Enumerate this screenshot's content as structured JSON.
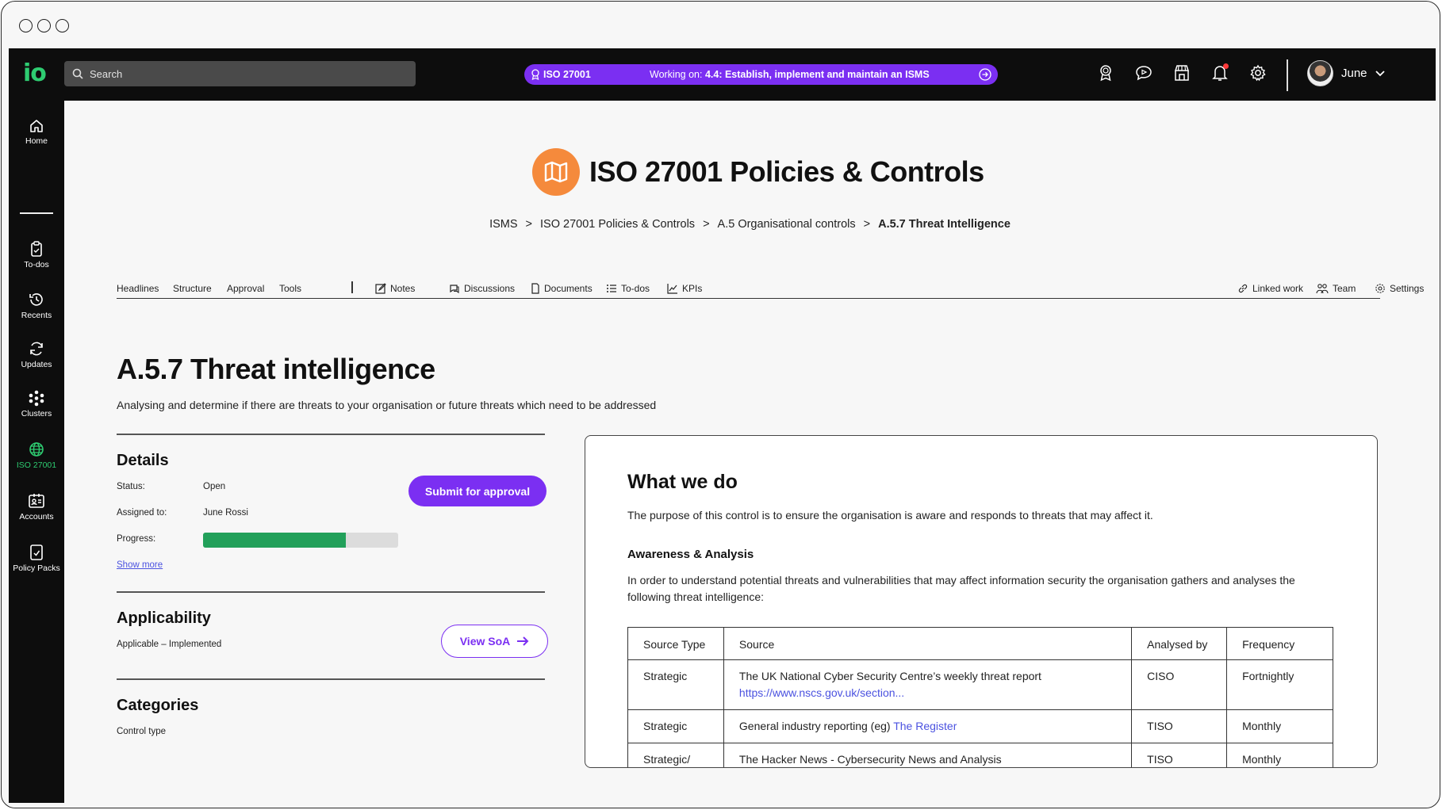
{
  "topbar": {
    "search_placeholder": "Search",
    "standard": "ISO 27001",
    "working_prefix": "Working on:",
    "working_task": "4.4: Establish, implement and maintain an ISMS",
    "user_name": "June",
    "icons": [
      "award-icon",
      "chat-icon",
      "store-icon",
      "bell-icon",
      "gear-icon"
    ]
  },
  "sidebar": {
    "items": [
      {
        "label": "Home",
        "icon": "home-icon"
      },
      {
        "label": "To-dos",
        "icon": "clipboard-icon"
      },
      {
        "label": "Recents",
        "icon": "history-icon"
      },
      {
        "label": "Updates",
        "icon": "refresh-icon"
      },
      {
        "label": "Clusters",
        "icon": "clusters-icon"
      },
      {
        "label": "ISO 27001",
        "icon": "globe-icon",
        "active": true
      },
      {
        "label": "Accounts",
        "icon": "id-card-icon"
      },
      {
        "label": "Policy Packs",
        "icon": "document-check-icon"
      }
    ]
  },
  "page": {
    "title": "ISO 27001 Policies & Controls",
    "breadcrumb": [
      "ISMS",
      "ISO 27001 Policies & Controls",
      "A.5 Organisational controls",
      "A.5.7 Threat Intelligence"
    ],
    "breadcrumb_sep": ">"
  },
  "tabs": {
    "left": [
      "Headlines",
      "Structure",
      "Approval",
      "Tools"
    ],
    "mid": [
      "Notes",
      "Discussions",
      "Documents",
      "To-dos",
      "KPIs"
    ],
    "right": [
      "Linked work",
      "Team",
      "Settings"
    ]
  },
  "control": {
    "title": "A.5.7 Threat intelligence",
    "description": "Analysing and determine if there are threats to your organisation or future threats which need to be addressed"
  },
  "details": {
    "heading": "Details",
    "status_label": "Status:",
    "status_value": "Open",
    "assigned_label": "Assigned to:",
    "assigned_value": "June Rossi",
    "progress_label": "Progress:",
    "progress": 0.73,
    "show_more": "Show more",
    "submit_button": "Submit for approval"
  },
  "applicability": {
    "heading": "Applicability",
    "value": "Applicable – Implemented",
    "view_button": "View SoA"
  },
  "categories": {
    "heading": "Categories",
    "control_type_label": "Control type"
  },
  "what_we_do": {
    "heading": "What we do",
    "intro": "The purpose of this control is to ensure the organisation is aware and responds to threats that may affect it.",
    "sub_heading": "Awareness & Analysis",
    "body": "In order to understand potential threats and vulnerabilities that may affect information security the organisation gathers and analyses the following threat intelligence:",
    "table": {
      "headers": [
        "Source Type",
        "Source",
        "Analysed by",
        "Frequency"
      ],
      "rows": [
        {
          "type": "Strategic",
          "source": "The UK National Cyber Security Centre’s weekly threat report",
          "link": "https://www.nscs.gov.uk/section...",
          "by": "CISO",
          "freq": "Fortnightly"
        },
        {
          "type": "Strategic",
          "source": "General industry reporting (eg)",
          "link": "The Register",
          "by": "TISO",
          "freq": "Monthly"
        },
        {
          "type": "Strategic/ Tactical",
          "source": "The Hacker News - Cybersecurity News and Analysis",
          "link": "",
          "by": "TISO",
          "freq": "Monthly"
        }
      ]
    }
  },
  "colors": {
    "accent": "#7b2ff2",
    "brand_green": "#2ecc71",
    "progress_green": "#22a05a",
    "title_icon_orange": "#f58a3c",
    "link_blue": "#4b52e0"
  }
}
